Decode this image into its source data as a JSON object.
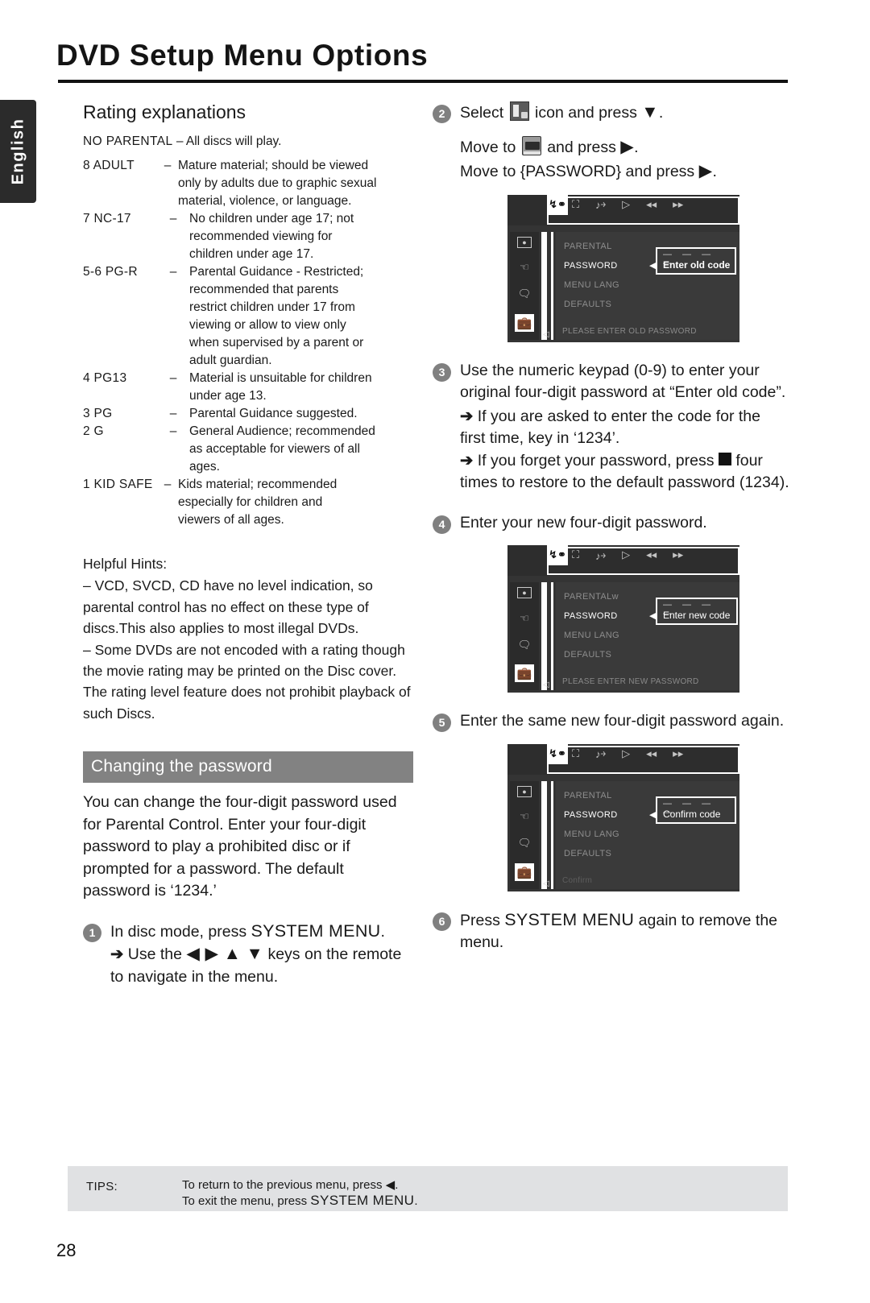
{
  "page": {
    "title": "DVD Setup Menu Options",
    "side_tab": "English",
    "number": "28"
  },
  "left": {
    "rating_heading": "Rating explanations",
    "no_parental": {
      "label": "NO PARENTAL",
      "dash": "–",
      "text": "All discs will play."
    },
    "ratings": [
      {
        "label": "8 ADULT",
        "dash": "–",
        "lines": [
          "Mature material; should be viewed",
          "only by adults due to graphic sexual",
          "material, violence, or language."
        ]
      },
      {
        "label": "7 NC-17",
        "dash": "–",
        "lines": [
          "No children under age 17; not",
          "recommended viewing for",
          "children under age 17."
        ]
      },
      {
        "label": "5-6 PG-R",
        "dash": "–",
        "lines": [
          "Parental Guidance - Restricted;",
          "recommended that parents",
          "restrict children under 17 from",
          "viewing or allow to view only",
          "when supervised by a parent or",
          "adult guardian."
        ]
      },
      {
        "label": "4 PG13",
        "dash": "–",
        "lines": [
          "Material is unsuitable for children",
          "under age 13."
        ]
      },
      {
        "label": "3 PG",
        "dash": "–",
        "lines": [
          "Parental Guidance suggested."
        ]
      },
      {
        "label": "2 G",
        "dash": "–",
        "lines": [
          "General Audience; recommended",
          "as acceptable for viewers of all",
          "ages."
        ]
      },
      {
        "label": "1 KID SAFE",
        "dash": "–",
        "lines": [
          "Kids material; recommended",
          "especially for children and",
          "viewers of all ages."
        ]
      }
    ],
    "hints_heading": "Helpful Hints:",
    "hints": [
      "–  VCD, SVCD, CD  have no level indication, so parental control has no effect on these type of discs.This also applies to most illegal DVDs.",
      "–  Some DVDs are not encoded with a rating though the movie rating may be printed on the Disc cover. The rating level feature does not prohibit playback of such Discs."
    ],
    "password_bar": "Changing the password",
    "password_body": "You can change the four-digit password used for Parental Control. Enter your four-digit password to play a prohibited disc or if prompted for a password. The default password is ‘1234.’",
    "step1": {
      "num": "1",
      "text_a": "In disc mode, press ",
      "text_b": "SYSTEM MENU",
      "text_c": ".",
      "sub_arrow": "➔",
      "sub_a": "Use the ",
      "sub_keys": "◀ ▶ ▲ ▼",
      "sub_b": " keys on the remote to navigate in the menu."
    }
  },
  "right": {
    "step2": {
      "num": "2",
      "line1_a": "Select ",
      "line1_icon": "preference-icon",
      "line1_b": " icon and press ",
      "line1_key": "▼",
      "line1_c": ".",
      "line2_a": "Move to ",
      "line2_icon": "tv-screen-icon",
      "line2_b": " and press ",
      "line2_key": "▶",
      "line2_c": ".",
      "line3_a": "Move to {PASSWORD} and press ",
      "line3_key": "▶",
      "line3_c": "."
    },
    "step3": {
      "num": "3",
      "text": "Use the numeric keypad (0-9) to enter your original four-digit password at “Enter old code”.",
      "bullets": [
        {
          "arrow": "➔",
          "text": "If you are asked to enter the code for the first time, key in ‘1234’."
        }
      ],
      "bullet2_a": "If you forget your password, press ",
      "bullet2_icon": "stop-square-icon",
      "bullet2_b": " four times to restore to the default password (1234)."
    },
    "step4": {
      "num": "4",
      "text": "Enter your new four-digit password."
    },
    "step5": {
      "num": "5",
      "text": "Enter the same new four-digit password again."
    },
    "step6": {
      "num": "6",
      "text_a": "Press ",
      "text_b": "SYSTEM MENU",
      "text_c": " again to remove the menu."
    }
  },
  "osd": {
    "tab_selected_icon": "setup-tools-icon",
    "tab_icons": [
      "display-icon",
      "audio-icon",
      "play-icon",
      "rewind-icon",
      "forward-icon"
    ],
    "side_icons": [
      "picture-icon",
      "speaker-icon",
      "subtitle-icon",
      "preference-briefcase-icon"
    ],
    "screens": [
      {
        "name": "enter-old-password",
        "menu": [
          "PARENTAL",
          "PASSWORD",
          "MENU LANG",
          "DEFAULTS"
        ],
        "selected": "PASSWORD",
        "dashes": "— — — —",
        "code_label": "Enter old code",
        "status": "PLEASE ENTER OLD PASSWORD"
      },
      {
        "name": "enter-new-password",
        "menu": [
          "PARENTALw",
          "PASSWORD",
          "MENU LANG",
          "DEFAULTS"
        ],
        "selected": "PASSWORD",
        "dashes": "— — — —",
        "code_label": "Enter new code",
        "status": "PLEASE ENTER NEW PASSWORD"
      },
      {
        "name": "confirm-password",
        "menu": [
          "PARENTAL",
          "PASSWORD",
          "MENU LANG",
          "DEFAULTS"
        ],
        "selected": "PASSWORD",
        "dashes": "— — — —",
        "code_label": "Confirm code",
        "status": "Confirm"
      }
    ]
  },
  "tips": {
    "label": "TIPS:",
    "line1_a": "To return to the previous menu, press ",
    "line1_key": "◀",
    "line1_b": ".",
    "line2_a": "To exit the menu, press ",
    "line2_b": "SYSTEM MENU",
    "line2_c": "."
  }
}
